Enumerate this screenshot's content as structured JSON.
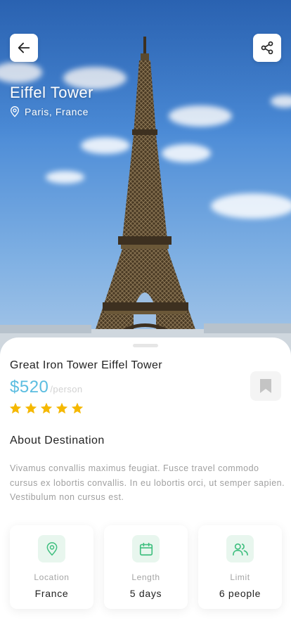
{
  "header": {
    "title": "Eiffel Tower",
    "location": "Paris, France"
  },
  "details": {
    "name": "Great Iron Tower Eiffel Tower",
    "price": "$520",
    "price_unit": "/person",
    "rating": 5,
    "about_title": "About Destination",
    "about_text": "Vivamus convallis maximus feugiat. Fusce travel commodo cursus ex lobortis convallis. In eu lobortis orci, ut semper sapien. Vestibulum non cursus est."
  },
  "info_cards": [
    {
      "label": "Location",
      "value": "France",
      "icon": "map-pin-icon"
    },
    {
      "label": "Length",
      "value": "5 days",
      "icon": "calendar-icon"
    },
    {
      "label": "Limit",
      "value": "6 people",
      "icon": "users-icon"
    }
  ],
  "colors": {
    "price": "#5bbde0",
    "star": "#f5b800",
    "card_icon": "#3fbf7f",
    "card_icon_bg": "#e8f6ee"
  }
}
